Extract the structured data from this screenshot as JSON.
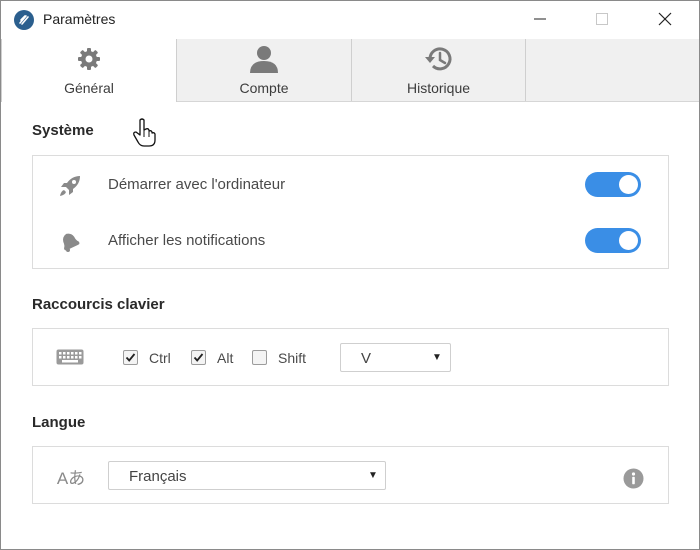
{
  "window": {
    "title": "Paramètres"
  },
  "tabs": [
    {
      "label": "Général",
      "icon": "gear-icon",
      "active": true
    },
    {
      "label": "Compte",
      "icon": "user-icon",
      "active": false
    },
    {
      "label": "Historique",
      "icon": "history-icon",
      "active": false
    }
  ],
  "systeme": {
    "title": "Système",
    "rows": [
      {
        "label": "Démarrer avec l'ordinateur",
        "icon": "rocket-icon",
        "enabled": true
      },
      {
        "label": "Afficher les notifications",
        "icon": "bell-icon",
        "enabled": true
      }
    ]
  },
  "raccourcis": {
    "title": "Raccourcis clavier",
    "icon": "keyboard-icon",
    "modifiers": [
      {
        "label": "Ctrl",
        "checked": true
      },
      {
        "label": "Alt",
        "checked": true
      },
      {
        "label": "Shift",
        "checked": false
      }
    ],
    "key": "V"
  },
  "langue": {
    "title": "Langue",
    "icon": "language-icon",
    "icon_text": "Aあ",
    "value": "Français",
    "info_icon": "info-icon"
  },
  "colors": {
    "accent": "#3a8ee6",
    "tabbar": "#f0f0f0",
    "icon_gray": "#8a8a8a"
  }
}
